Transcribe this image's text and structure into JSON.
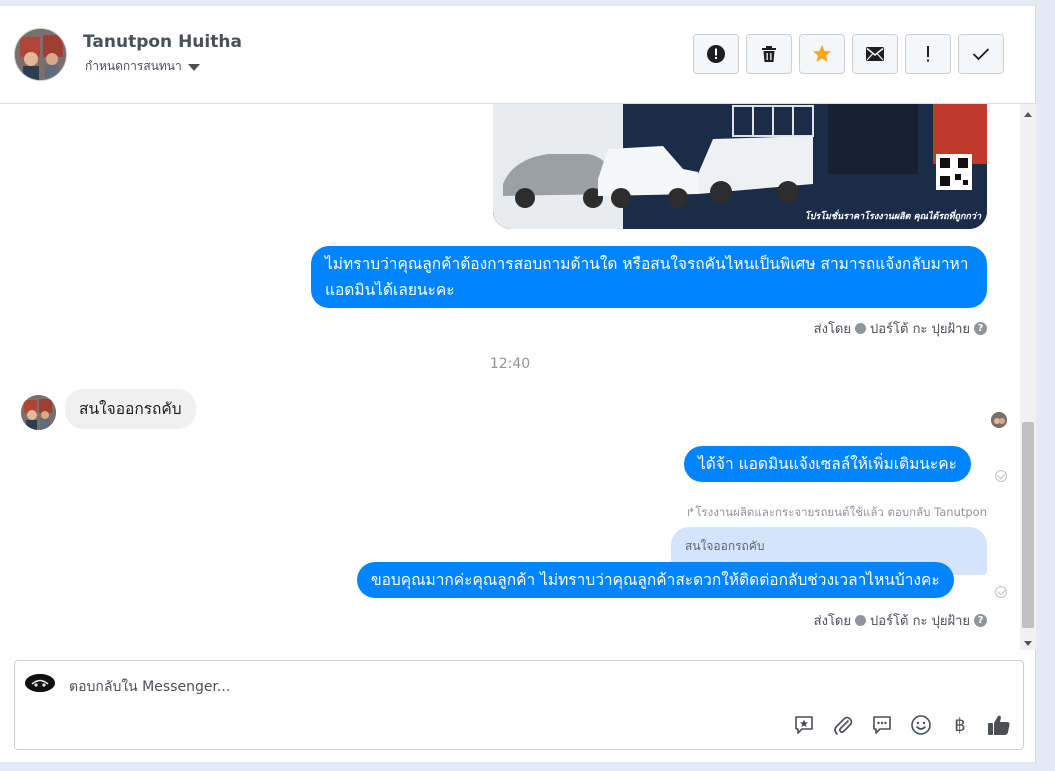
{
  "header": {
    "contact_name": "Tanutpon Huitha",
    "assign_label": "กำหนดการสนทนา",
    "toolbar": [
      {
        "name": "block-button",
        "icon": "alert-circle-icon"
      },
      {
        "name": "delete-button",
        "icon": "trash-icon"
      },
      {
        "name": "star-button",
        "icon": "star-icon"
      },
      {
        "name": "mark-unread-button",
        "icon": "envelope-icon"
      },
      {
        "name": "important-button",
        "icon": "exclamation-icon"
      },
      {
        "name": "done-button",
        "icon": "check-icon"
      }
    ]
  },
  "conversation": {
    "promo_caption": "โปรโมชั่นราคาโรงงานผลิต คุณได้รถที่ถูกกว่า",
    "msg_out_1": "ไม่ทราบว่าคุณลูกค้าต้องการสอบถามด้านใด หรือสนใจรถคันไหนเป็นพิเศษ สามารถแจ้งกลับมาหาแอดมินได้เลยนะคะ",
    "sent_by_prefix": "ส่งโดย",
    "sent_by_name": "ปอร์โต้ กะ ปุยฝ้าย",
    "help_glyph": "?",
    "timestamp": "12:40",
    "msg_in_1": "สนใจออกรถคับ",
    "msg_out_2": "ได้จ้า แอดมินแจ้งเซลล์ให้เพิ่มเติมนะคะ",
    "reply_label": "โรงงานผลิตและกระจายรถยนต์ใช้แล้ว ตอบกลับ Tanutpon",
    "reply_quote": "สนใจออกรถคับ",
    "msg_out_3": "ขอบคุณมากค่ะคุณลูกค้า ไม่ทราบว่าคุณลูกค้าสะดวกให้ติดต่อกลับช่วงเวลาไหนบ้างคะ"
  },
  "composer": {
    "placeholder": "ตอบกลับใน Messenger...",
    "tools": [
      {
        "name": "saved-reply-button",
        "icon": "star-bubble-icon"
      },
      {
        "name": "attach-button",
        "icon": "paperclip-icon"
      },
      {
        "name": "chat-bubble-button",
        "icon": "chat-bubble-icon"
      },
      {
        "name": "emoji-button",
        "icon": "smiley-icon"
      },
      {
        "name": "payment-button",
        "icon": "baht-icon"
      },
      {
        "name": "like-button",
        "icon": "thumbs-up-icon"
      }
    ],
    "baht_glyph": "฿"
  },
  "colors": {
    "accent": "#0084ff",
    "incoming_bubble": "#f1f0f0",
    "quote_bubble": "#d4e4fc",
    "star": "#f5a623"
  }
}
